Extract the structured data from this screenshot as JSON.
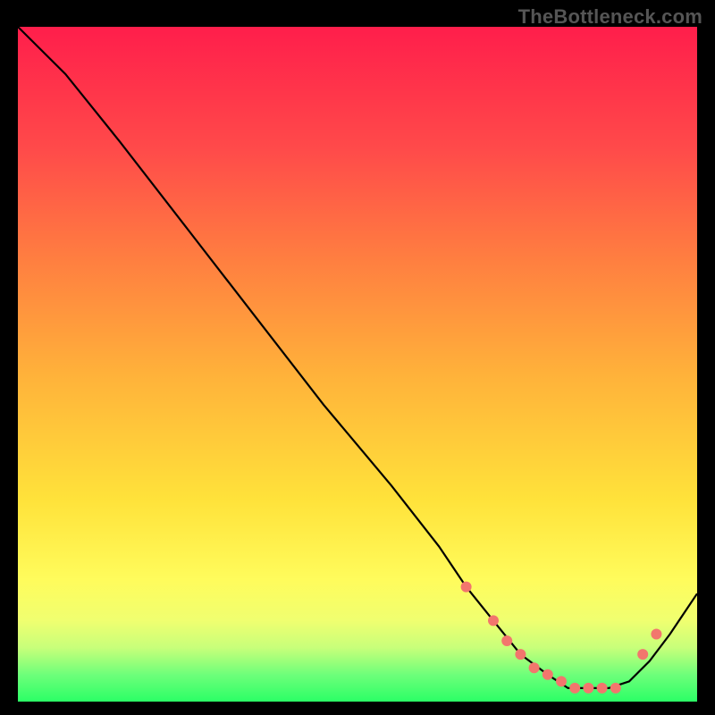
{
  "watermark": "TheBottleneck.com",
  "chart_data": {
    "type": "line",
    "title": "",
    "xlabel": "",
    "ylabel": "",
    "xlim": [
      0,
      100
    ],
    "ylim": [
      0,
      100
    ],
    "grid": false,
    "legend": false,
    "annotations": [],
    "background_gradient": {
      "direction": "vertical",
      "stops": [
        {
          "pos": 0.0,
          "color": "#ff1e4b"
        },
        {
          "pos": 0.18,
          "color": "#ff4a4a"
        },
        {
          "pos": 0.35,
          "color": "#ff8040"
        },
        {
          "pos": 0.52,
          "color": "#ffb33a"
        },
        {
          "pos": 0.7,
          "color": "#ffe23a"
        },
        {
          "pos": 0.82,
          "color": "#fffc5c"
        },
        {
          "pos": 0.88,
          "color": "#f0ff70"
        },
        {
          "pos": 0.92,
          "color": "#c8ff7a"
        },
        {
          "pos": 0.96,
          "color": "#6eff7a"
        },
        {
          "pos": 1.0,
          "color": "#2bff66"
        }
      ]
    },
    "series": [
      {
        "name": "bottleneck-curve",
        "color": "#000000",
        "x": [
          0,
          7,
          15,
          25,
          35,
          45,
          55,
          62,
          66,
          70,
          74,
          78,
          81,
          84,
          87,
          90,
          93,
          96,
          100
        ],
        "y": [
          100,
          93,
          83,
          70,
          57,
          44,
          32,
          23,
          17,
          12,
          7,
          4,
          2,
          2,
          2,
          3,
          6,
          10,
          16
        ]
      }
    ],
    "markers": {
      "name": "highlighted-points",
      "color": "#f2766d",
      "radius": 6,
      "x": [
        66,
        70,
        72,
        74,
        76,
        78,
        80,
        82,
        84,
        86,
        88,
        92,
        94
      ],
      "y": [
        17,
        12,
        9,
        7,
        5,
        4,
        3,
        2,
        2,
        2,
        2,
        7,
        10
      ]
    }
  }
}
